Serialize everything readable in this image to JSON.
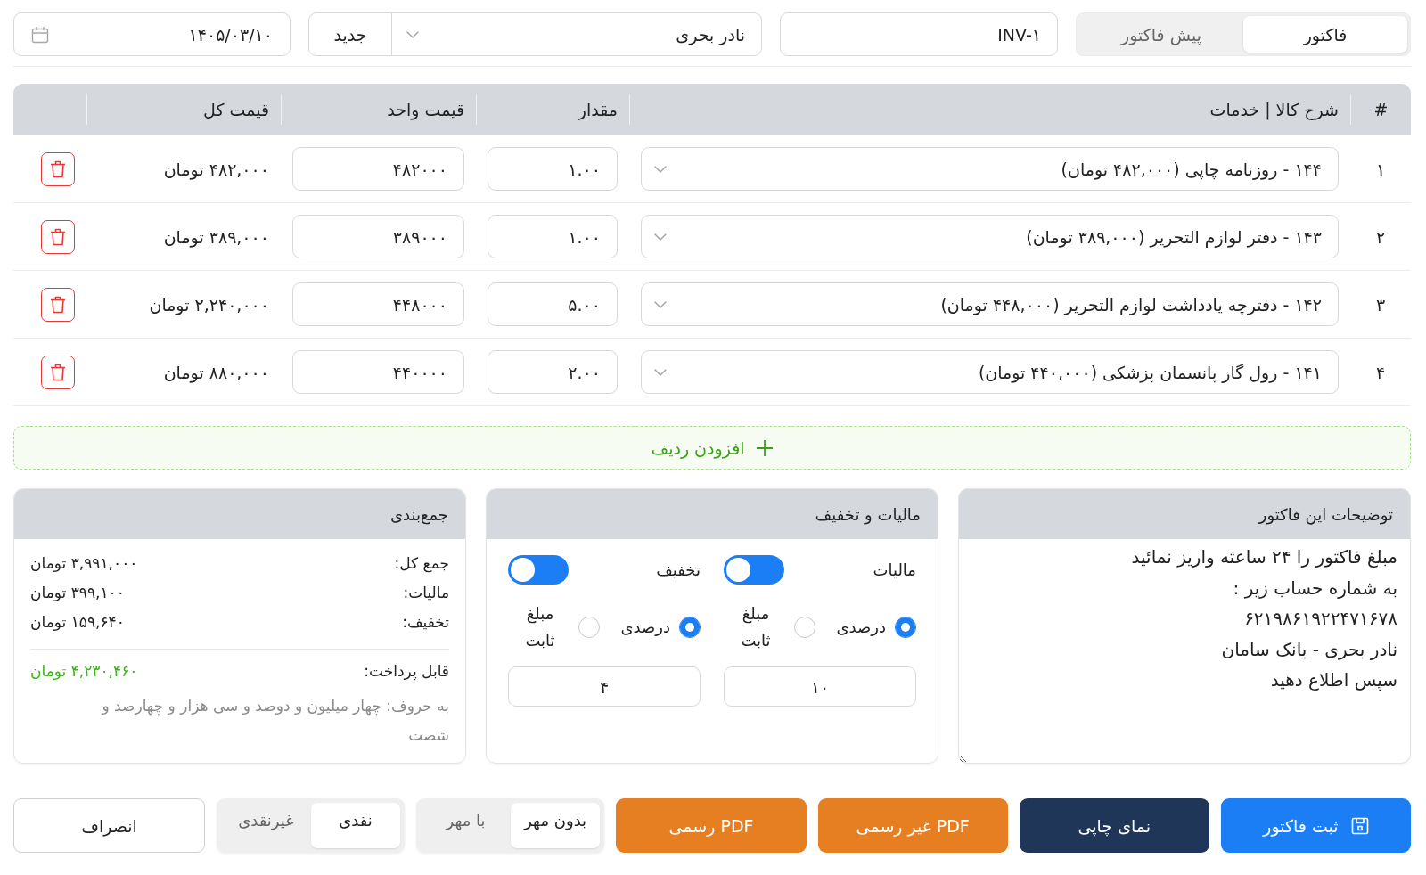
{
  "document_type_tabs": [
    {
      "label": "فاکتور",
      "selected": true
    },
    {
      "label": "پیش فاکتور",
      "selected": false
    }
  ],
  "invoice_number": {
    "value": "INV-۱"
  },
  "customer": {
    "value": "نادر بحری",
    "new_button": "جدید"
  },
  "date": {
    "value": "۱۴۰۵/۰۳/۱۰"
  },
  "items_table": {
    "columns": [
      "#",
      "شرح کالا | خدمات",
      "مقدار",
      "قیمت واحد",
      "قیمت کل"
    ],
    "rows": [
      {
        "index": "۱",
        "product": "۱۴۴ - روزنامه چاپی (۴۸۲,۰۰۰ تومان)",
        "quantity": "۱.۰۰",
        "unit_price": "۴۸۲۰۰۰",
        "total": "۴۸۲,۰۰۰ تومان"
      },
      {
        "index": "۲",
        "product": "۱۴۳ - دفتر لوازم التحریر (۳۸۹,۰۰۰ تومان)",
        "quantity": "۱.۰۰",
        "unit_price": "۳۸۹۰۰۰",
        "total": "۳۸۹,۰۰۰ تومان"
      },
      {
        "index": "۳",
        "product": "۱۴۲ - دفترچه یادداشت لوازم التحریر (۴۴۸,۰۰۰ تومان)",
        "quantity": "۵.۰۰",
        "unit_price": "۴۴۸۰۰۰",
        "total": "۲,۲۴۰,۰۰۰ تومان"
      },
      {
        "index": "۴",
        "product": "۱۴۱ - رول گاز پانسمان پزشکی (۴۴۰,۰۰۰ تومان)",
        "quantity": "۲.۰۰",
        "unit_price": "۴۴۰۰۰۰",
        "total": "۸۸۰,۰۰۰ تومان"
      }
    ]
  },
  "add_row_button": "افزودن ردیف",
  "notes": {
    "title": "توضیحات این فاکتور",
    "value": "مبلغ فاکتور را ۲۴ ساعته واریز نمائید\nبه شماره حساب زیر :\n۶۲۱۹۸۶۱۹۲۲۴۷۱۶۷۸\nنادر بحری - بانک سامان\nسپس اطلاع دهید"
  },
  "tax_discount": {
    "title": "مالیات و تخفیف",
    "groups": [
      {
        "label": "مالیات",
        "on": true,
        "options": [
          {
            "label": "درصدی",
            "selected": true
          },
          {
            "label": "مبلغ ثابت",
            "selected": false
          }
        ],
        "value": "۱۰"
      },
      {
        "label": "تخفیف",
        "on": true,
        "options": [
          {
            "label": "درصدی",
            "selected": true
          },
          {
            "label": "مبلغ ثابت",
            "selected": false
          }
        ],
        "value": "۴"
      }
    ]
  },
  "summary": {
    "title": "جمع‌بندی",
    "lines": [
      {
        "label": "جمع کل:",
        "value": "۳,۹۹۱,۰۰۰ تومان"
      },
      {
        "label": "مالیات:",
        "value": "۳۹۹,۱۰۰ تومان"
      },
      {
        "label": "تخفیف:",
        "value": "۱۵۹,۶۴۰ تومان"
      }
    ],
    "payable": {
      "label": "قابل پرداخت:",
      "value": "۴,۲۳۰,۴۶۰ تومان"
    },
    "in_words": "به حروف: چهار میلیون و دوصد و سی هزار و چهارصد و شصت"
  },
  "actions": [
    {
      "label": "ثبت فاکتور",
      "kind": "primary"
    },
    {
      "label": "نمای چاپی",
      "kind": "dark"
    },
    {
      "label": "PDF غیر رسمی",
      "kind": "warning"
    },
    {
      "label": "PDF رسمی",
      "kind": "warning"
    }
  ],
  "stamp_options": [
    {
      "label": "بدون مهر",
      "selected": true
    },
    {
      "label": "با مهر",
      "selected": false
    }
  ],
  "payment_options": [
    {
      "label": "نقدی",
      "selected": true
    },
    {
      "label": "غیرنقدی",
      "selected": false
    }
  ],
  "cancel_button": "انصراف"
}
